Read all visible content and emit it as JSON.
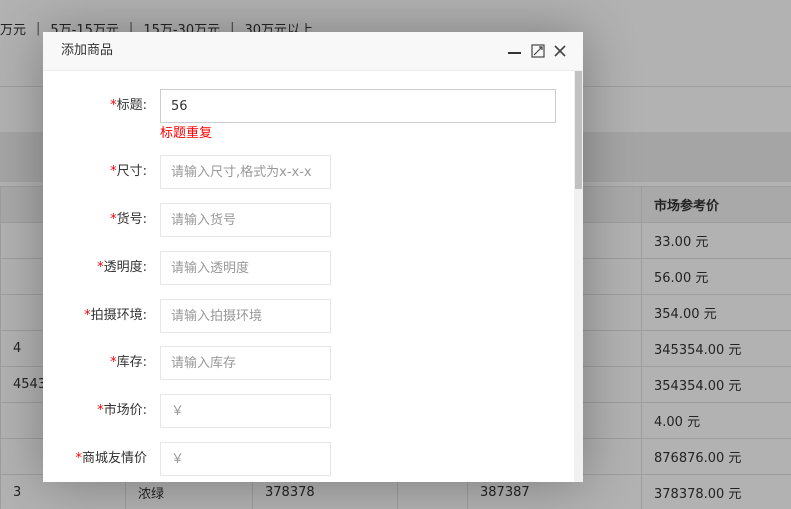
{
  "background": {
    "filters": [
      "万元",
      "5万-15万元",
      "15万-30万元",
      "30万元以上"
    ],
    "filter_separator": "|",
    "table_header": [
      "",
      "",
      "",
      "",
      "",
      "市场参考价"
    ],
    "table_rows": [
      [
        "",
        "",
        "",
        "",
        "",
        "33.00 元"
      ],
      [
        "",
        "",
        "",
        "",
        "",
        "56.00 元"
      ],
      [
        "",
        "",
        "",
        "",
        "",
        "354.00 元"
      ],
      [
        "4",
        "",
        "",
        "",
        "",
        "345354.00 元"
      ],
      [
        "4543",
        "",
        "",
        "",
        "",
        "354354.00 元"
      ],
      [
        "",
        "",
        "",
        "",
        "",
        "4.00 元"
      ],
      [
        "",
        "",
        "",
        "",
        "",
        "876876.00 元"
      ],
      [
        "3",
        "浓绿",
        "378378",
        "",
        "387387",
        "378378.00 元"
      ]
    ]
  },
  "modal": {
    "title": "添加商品",
    "controls": {
      "minimize_icon": "minimize-icon",
      "maximize_icon": "maximize-icon",
      "close_icon": "close-icon"
    },
    "required_mark": "*",
    "fields": {
      "title": {
        "label": "标题:",
        "value": "56",
        "error": "标题重复"
      },
      "size": {
        "label": "尺寸:",
        "placeholder": "请输入尺寸,格式为x-x-x"
      },
      "item_no": {
        "label": "货号:",
        "placeholder": "请输入货号"
      },
      "transparency": {
        "label": "透明度:",
        "placeholder": "请输入透明度"
      },
      "shooting_env": {
        "label": "拍摄环境:",
        "placeholder": "请输入拍摄环境"
      },
      "stock": {
        "label": "库存:",
        "placeholder": "请输入库存"
      },
      "market_price": {
        "label": "市场价:",
        "placeholder": "￥"
      },
      "mall_price": {
        "label": "商城友情价",
        "placeholder": "￥"
      }
    }
  },
  "colors": {
    "required": "#ff0000",
    "error": "#ff0000",
    "overlay": "rgba(0,0,0,0.3)"
  }
}
